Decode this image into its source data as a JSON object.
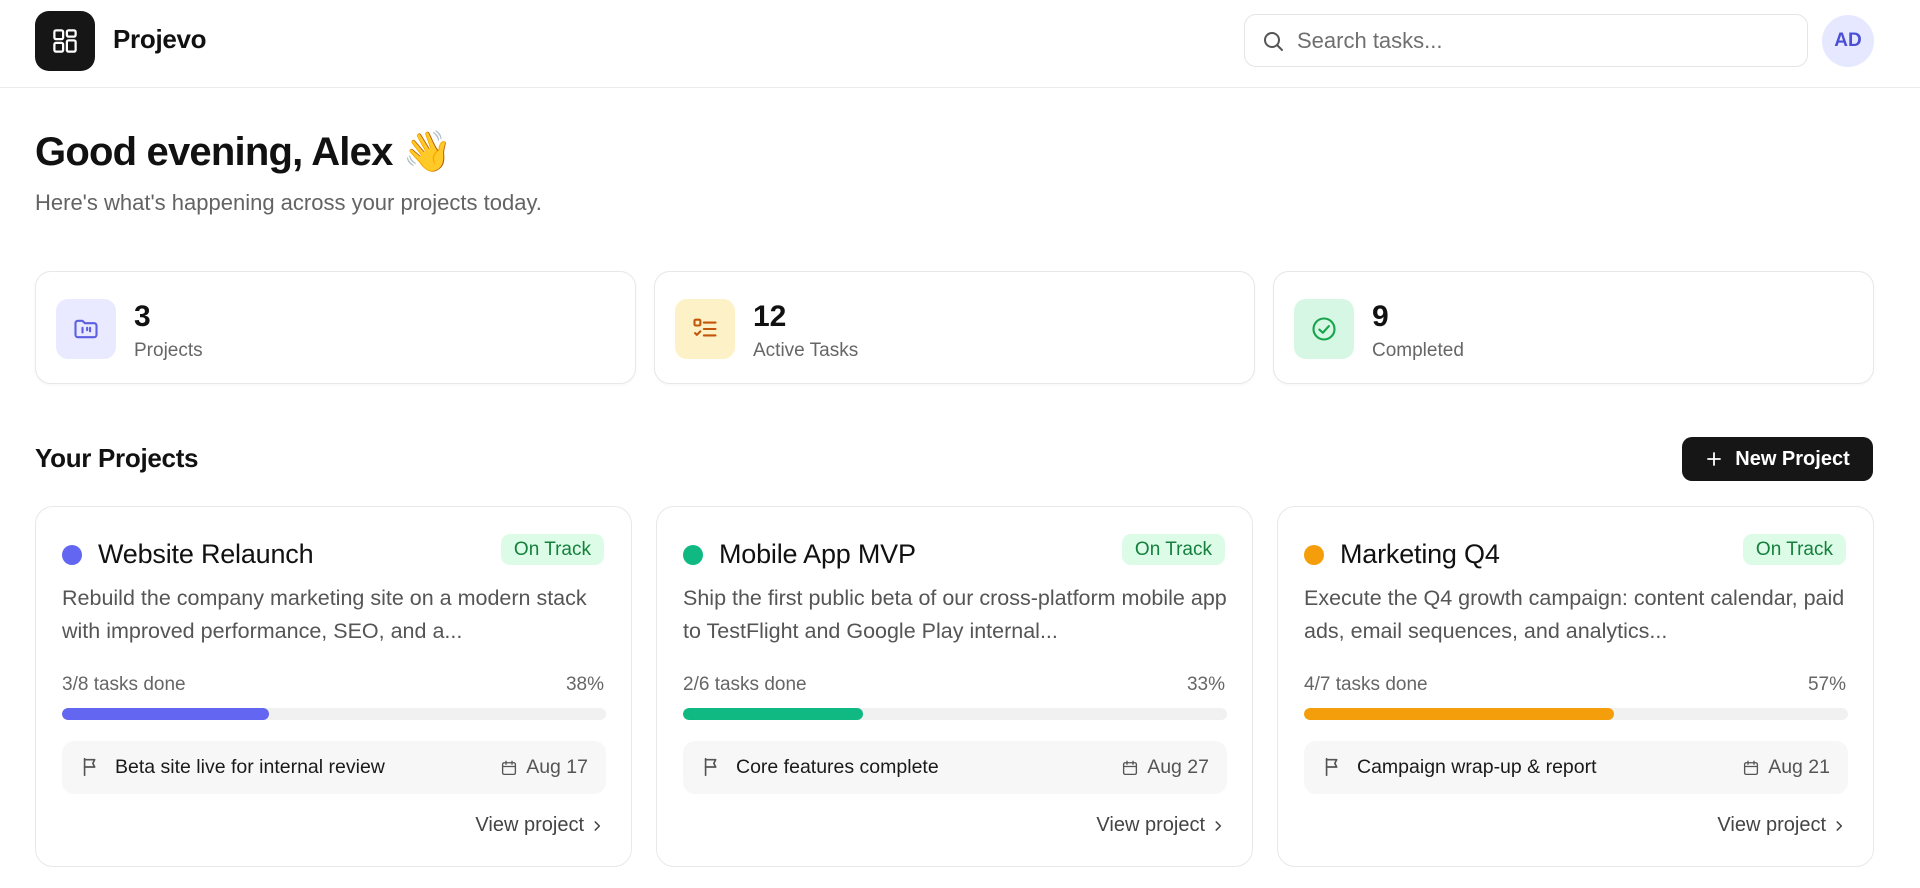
{
  "header": {
    "brand": "Projevo",
    "search_placeholder": "Search tasks...",
    "avatar_initials": "AD"
  },
  "greeting": {
    "title": "Good evening, Alex 👋",
    "subtitle": "Here's what's happening across your projects today."
  },
  "stats": [
    {
      "value": "3",
      "label": "Projects",
      "icon": "folder-icon",
      "bg": "#e9eaff",
      "color": "#5b5fe0"
    },
    {
      "value": "12",
      "label": "Active Tasks",
      "icon": "task-list-icon",
      "bg": "#fdf1c7",
      "color": "#c2570c"
    },
    {
      "value": "9",
      "label": "Completed",
      "icon": "check-circle-icon",
      "bg": "#d6f7e3",
      "color": "#16a34a"
    }
  ],
  "projects_section": {
    "title": "Your Projects",
    "new_button": "New Project"
  },
  "projects": [
    {
      "name": "Website Relaunch",
      "status": "On Track",
      "color": "#6366f1",
      "description": "Rebuild the company marketing site on a modern stack with improved performance, SEO, and a...",
      "tasks_done": "3/8 tasks done",
      "percent_label": "38%",
      "progress": 0.38,
      "milestone": "Beta site live for internal review",
      "milestone_date": "Aug 17",
      "view_label": "View project"
    },
    {
      "name": "Mobile App MVP",
      "status": "On Track",
      "color": "#10b981",
      "description": "Ship the first public beta of our cross-platform mobile app to TestFlight and Google Play internal...",
      "tasks_done": "2/6 tasks done",
      "percent_label": "33%",
      "progress": 0.33,
      "milestone": "Core features complete",
      "milestone_date": "Aug 27",
      "view_label": "View project"
    },
    {
      "name": "Marketing Q4",
      "status": "On Track",
      "color": "#f59e0b",
      "description": "Execute the Q4 growth campaign: content calendar, paid ads, email sequences, and analytics...",
      "tasks_done": "4/7 tasks done",
      "percent_label": "57%",
      "progress": 0.57,
      "milestone": "Campaign wrap-up & report",
      "milestone_date": "Aug 21",
      "view_label": "View project"
    }
  ]
}
